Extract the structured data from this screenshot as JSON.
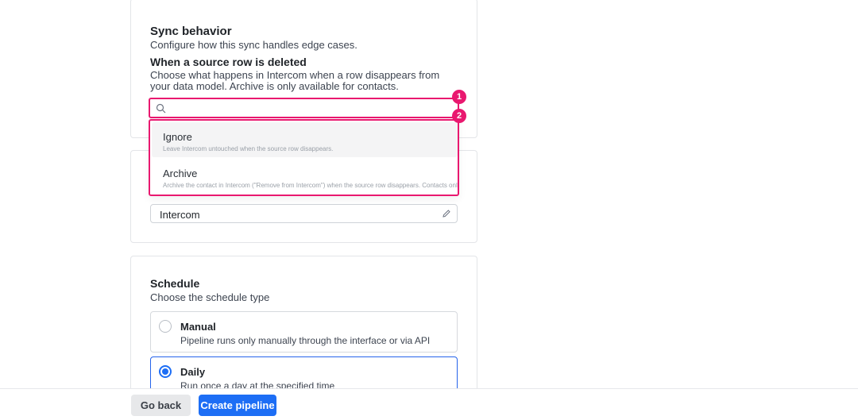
{
  "sync_behavior": {
    "title": "Sync behavior",
    "subtitle": "Configure how this sync handles edge cases.",
    "deleted_heading": "When a source row is deleted",
    "deleted_desc": "Choose what happens in Intercom when a row disappears from your data model. Archive is only available for contacts.",
    "search": {
      "value": "",
      "placeholder": ""
    },
    "options": [
      {
        "label": "Ignore",
        "help": "Leave Intercom untouched when the source row disappears."
      },
      {
        "label": "Archive",
        "help": "Archive the contact in Intercom (\"Remove from Intercom\") when the source row disappears. Contacts only."
      }
    ]
  },
  "annotations": {
    "badge1": "1",
    "badge2": "2",
    "color": "#e9186f"
  },
  "destination": {
    "name_value": "Intercom"
  },
  "schedule": {
    "title": "Schedule",
    "subtitle": "Choose the schedule type",
    "options": [
      {
        "title": "Manual",
        "desc": "Pipeline runs only manually through the interface or via API",
        "selected": false
      },
      {
        "title": "Daily",
        "desc": "Run once a day at the specified time",
        "selected": true
      }
    ]
  },
  "footer": {
    "back_label": "Go back",
    "create_label": "Create pipeline",
    "accent": "#1d6ef5"
  },
  "icons": {
    "search": "search-icon",
    "edit": "pencil-icon"
  }
}
